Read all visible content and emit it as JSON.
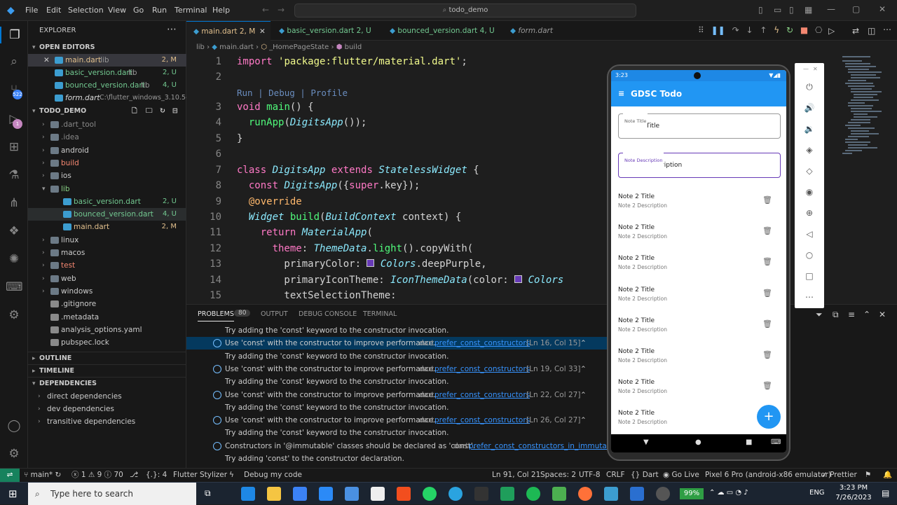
{
  "titlebar": {
    "menus": [
      "File",
      "Edit",
      "Selection",
      "View",
      "Go",
      "Run",
      "Terminal",
      "Help"
    ],
    "search": "todo_demo"
  },
  "activity": {
    "badges": [
      "522",
      "1"
    ]
  },
  "explorer": {
    "title": "EXPLORER",
    "open_editors": "OPEN EDITORS",
    "open": [
      {
        "name": "main.dart",
        "dir": "lib",
        "status": "2, M"
      },
      {
        "name": "basic_version.dart",
        "dir": "lib",
        "status": "2, U"
      },
      {
        "name": "bounced_version.dart",
        "dir": "lib",
        "status": "4, U"
      },
      {
        "name": "form.dart",
        "dir": "C:\\flutter_windows_3.10.5-s...",
        "status": ""
      }
    ],
    "project": "TODO_DEMO",
    "tree": [
      {
        "name": ".dart_tool",
        "type": "folder"
      },
      {
        "name": ".idea",
        "type": "folder"
      },
      {
        "name": "android",
        "type": "folder"
      },
      {
        "name": "build",
        "type": "folder"
      },
      {
        "name": "ios",
        "type": "folder"
      },
      {
        "name": "lib",
        "type": "folder-open"
      },
      {
        "name": "basic_version.dart",
        "type": "file",
        "status": "2, U"
      },
      {
        "name": "bounced_version.dart",
        "type": "file",
        "status": "4, U"
      },
      {
        "name": "main.dart",
        "type": "file",
        "status": "2, M"
      },
      {
        "name": "linux",
        "type": "folder"
      },
      {
        "name": "macos",
        "type": "folder"
      },
      {
        "name": "test",
        "type": "folder"
      },
      {
        "name": "web",
        "type": "folder"
      },
      {
        "name": "windows",
        "type": "folder"
      },
      {
        "name": ".gitignore",
        "type": "file"
      },
      {
        "name": ".metadata",
        "type": "file"
      },
      {
        "name": "analysis_options.yaml",
        "type": "file"
      },
      {
        "name": "pubspec.lock",
        "type": "file"
      }
    ],
    "outline": "OUTLINE",
    "timeline": "TIMELINE",
    "dependencies": "DEPENDENCIES",
    "deps": [
      "direct dependencies",
      "dev dependencies",
      "transitive dependencies"
    ]
  },
  "tabs": [
    {
      "label": "main.dart",
      "status": "2, M"
    },
    {
      "label": "basic_version.dart",
      "status": "2, U"
    },
    {
      "label": "bounced_version.dart",
      "status": "4, U"
    },
    {
      "label": "form.dart",
      "status": ""
    }
  ],
  "breadcrumb": [
    "lib",
    "main.dart",
    "_HomePageState",
    "build"
  ],
  "code": {
    "line_numbers": [
      "1",
      "2",
      "",
      "3",
      "4",
      "5",
      "6",
      "7",
      "8",
      "9",
      "10",
      "11",
      "12",
      "13",
      "14",
      "15"
    ],
    "codelens": "Run | Debug | Profile"
  },
  "panel": {
    "tabs": [
      "PROBLEMS",
      "80",
      "OUTPUT",
      "DEBUG CONSOLE",
      "TERMINAL"
    ],
    "rows": [
      {
        "kind": "hint",
        "text": "Try adding the 'const' keyword to the constructor invocation."
      },
      {
        "kind": "msg",
        "text": "Use 'const' with the constructor to improve performance.",
        "src": "dart",
        "link": "prefer_const_constructors",
        "loc": "[Ln 16, Col 15]"
      },
      {
        "kind": "hint",
        "text": "Try adding the 'const' keyword to the constructor invocation."
      },
      {
        "kind": "msg",
        "text": "Use 'const' with the constructor to improve performance.",
        "src": "dart",
        "link": "prefer_const_constructors",
        "loc": "[Ln 19, Col 33]"
      },
      {
        "kind": "hint",
        "text": "Try adding the 'const' keyword to the constructor invocation."
      },
      {
        "kind": "msg",
        "text": "Use 'const' with the constructor to improve performance.",
        "src": "dart",
        "link": "prefer_const_constructors",
        "loc": "[Ln 22, Col 27]"
      },
      {
        "kind": "hint",
        "text": "Try adding the 'const' keyword to the constructor invocation."
      },
      {
        "kind": "msg",
        "text": "Use 'const' with the constructor to improve performance.",
        "src": "dart",
        "link": "prefer_const_constructors",
        "loc": "[Ln 26, Col 27]"
      },
      {
        "kind": "hint",
        "text": "Try adding the 'const' keyword to the constructor invocation."
      },
      {
        "kind": "msg",
        "text": "Constructors in '@immutable' classes should be declared as 'const'.",
        "src": "dart",
        "link": "prefer_const_constructors_in_immutables",
        "loc": ""
      },
      {
        "kind": "hint",
        "text": "Try adding 'const' to the constructor declaration."
      }
    ]
  },
  "status": {
    "branch": "main*",
    "errors": "1",
    "warnings": "9",
    "infos": "70",
    "misc": "{.}: 4",
    "stylizer": "Flutter Stylizer",
    "debug": "Debug my code",
    "position": "Ln 91, Col 21",
    "spaces": "Spaces: 2",
    "encoding": "UTF-8",
    "eol": "CRLF",
    "lang": "Dart",
    "golive": "Go Live",
    "device": "Pixel 6 Pro (android-x86 emulator)",
    "prettier": "Prettier"
  },
  "taskbar": {
    "search": "Type here to search",
    "battery": "99%",
    "lang": "ENG",
    "time": "3:23 PM",
    "date": "7/26/2023"
  },
  "phone": {
    "time": "3:23",
    "app_title": "GDSC Todo",
    "title_label": "Note Title",
    "title_value": "Note 2 Title",
    "desc_label": "Note Description",
    "desc_value": "Note 2|Description",
    "items": [
      {
        "t": "Note 2 Title",
        "d": "Note 2 Description"
      },
      {
        "t": "Note 2 Title",
        "d": "Note 2 Description"
      },
      {
        "t": "Note 2 Title",
        "d": "Note 2 Description"
      },
      {
        "t": "Note 2 Title",
        "d": "Note 2 Description"
      },
      {
        "t": "Note 2 Title",
        "d": "Note 2 Description"
      },
      {
        "t": "Note 2 Title",
        "d": "Note 2 Description"
      },
      {
        "t": "Note 2 Title",
        "d": "Note 2 Description"
      },
      {
        "t": "Note 2 Title",
        "d": "Note 2 Description"
      }
    ],
    "fab": "+"
  }
}
